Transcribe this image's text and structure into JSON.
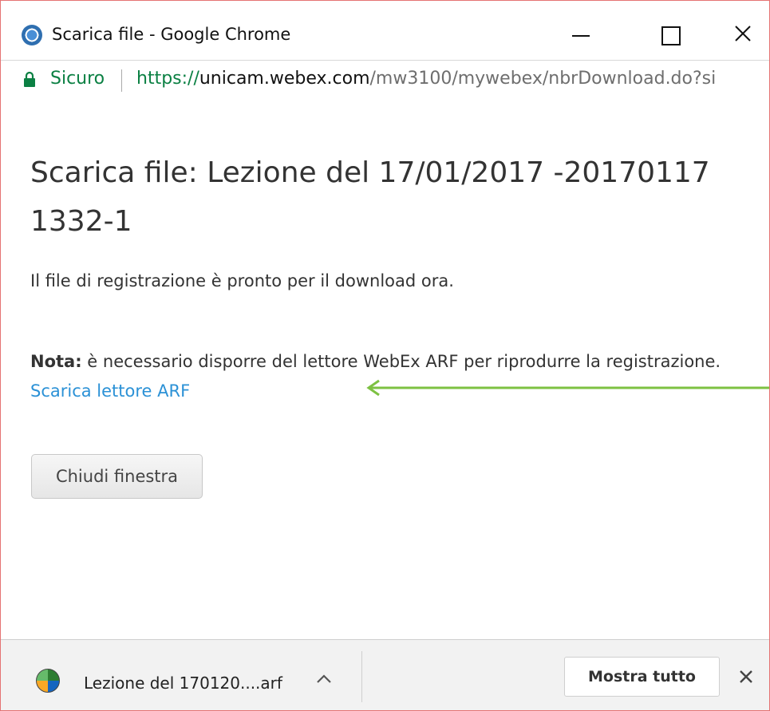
{
  "window": {
    "title": "Scarica file - Google Chrome",
    "icon": "chrome-icon",
    "controls": [
      "minimize-icon",
      "maximize-icon",
      "close-icon"
    ]
  },
  "address_bar": {
    "security_label": "Sicuro",
    "url_scheme": "https://",
    "url_host": "unicam.webex.com",
    "url_path": "/mw3100/mywebex/nbrDownload.do?si"
  },
  "page": {
    "heading": "Scarica file: Lezione del 17/01/2017 -20170117 1332-1",
    "message": "Il file di registrazione è pronto per il download ora.",
    "note_label": "Nota:",
    "note_text": " è necessario disporre del lettore WebEx ARF per riprodurre la registrazione. ",
    "player_link": "Scarica lettore ARF",
    "close_button": "Chiudi finestra",
    "arrow_color": "#7dc142"
  },
  "download_bar": {
    "file_name": "Lezione del 170120....arf",
    "show_all": "Mostra tutto"
  }
}
